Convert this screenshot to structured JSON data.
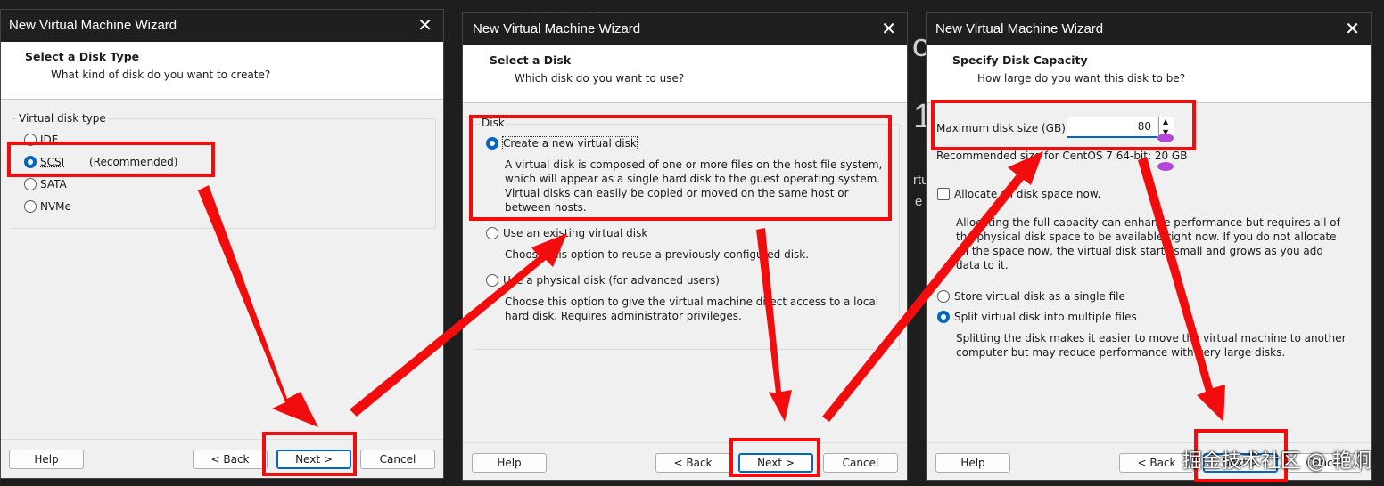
{
  "background": {
    "fragment_a": "ROOT",
    "fragment_b": "1",
    "fragment_c": "rtu",
    "fragment_d": "e",
    "fragment_e": "o"
  },
  "wizard1": {
    "title": "New Virtual Machine Wizard",
    "heading": "Select a Disk Type",
    "subheading": "What kind of disk do you want to create?",
    "group_label": "Virtual disk type",
    "options": [
      {
        "label": "IDE",
        "selected": false
      },
      {
        "label": "SCSI",
        "selected": true
      },
      {
        "label": "SATA",
        "selected": false
      },
      {
        "label": "NVMe",
        "selected": false
      }
    ],
    "recommended": "(Recommended)",
    "buttons": {
      "help": "Help",
      "back": "< Back",
      "next": "Next >",
      "cancel": "Cancel"
    }
  },
  "wizard2": {
    "title": "New Virtual Machine Wizard",
    "heading": "Select a Disk",
    "subheading": "Which disk do you want to use?",
    "group_label": "Disk",
    "options": [
      {
        "label": "Create a new virtual disk",
        "selected": true,
        "description": "A virtual disk is composed of one or more files on the host file system, which will appear as a single hard disk to the guest operating system. Virtual disks can easily be copied or moved on the same host or between hosts."
      },
      {
        "label": "Use an existing virtual disk",
        "selected": false,
        "description": "Choose this option to reuse a previously configured disk."
      },
      {
        "label": "Use a physical disk (for advanced users)",
        "selected": false,
        "description": "Choose this option to give the virtual machine direct access to a local hard disk. Requires administrator privileges."
      }
    ],
    "buttons": {
      "help": "Help",
      "back": "< Back",
      "next": "Next >",
      "cancel": "Cancel"
    }
  },
  "wizard3": {
    "title": "New Virtual Machine Wizard",
    "heading": "Specify Disk Capacity",
    "subheading": "How large do you want this disk to be?",
    "max_size_label": "Maximum disk size (GB):",
    "max_size_value": "80",
    "recommended": "Recommended size for CentOS 7 64-bit: 20 GB",
    "allocate_label": "Allocate all disk space now.",
    "allocate_checked": false,
    "allocate_description": "Allocating the full capacity can enhance performance but requires all of the physical disk space to be available right now. If you do not allocate all the space now, the virtual disk starts small and grows as you add data to it.",
    "options": [
      {
        "label": "Store virtual disk as a single file",
        "selected": false
      },
      {
        "label": "Split virtual disk into multiple files",
        "selected": true
      }
    ],
    "split_description": "Splitting the disk makes it easier to move the virtual machine to another computer but may reduce performance with very large disks.",
    "buttons": {
      "help": "Help",
      "back": "< Back",
      "next": "Next >",
      "cancel": "Cancel"
    }
  },
  "watermark": "掘金技术社区 @ 艳炯",
  "colors": {
    "annotation_red": "#f10d0d",
    "accent": "#0067c0",
    "titlebar": "#1f1f1f",
    "dialog_bg": "#f0f0f0"
  }
}
